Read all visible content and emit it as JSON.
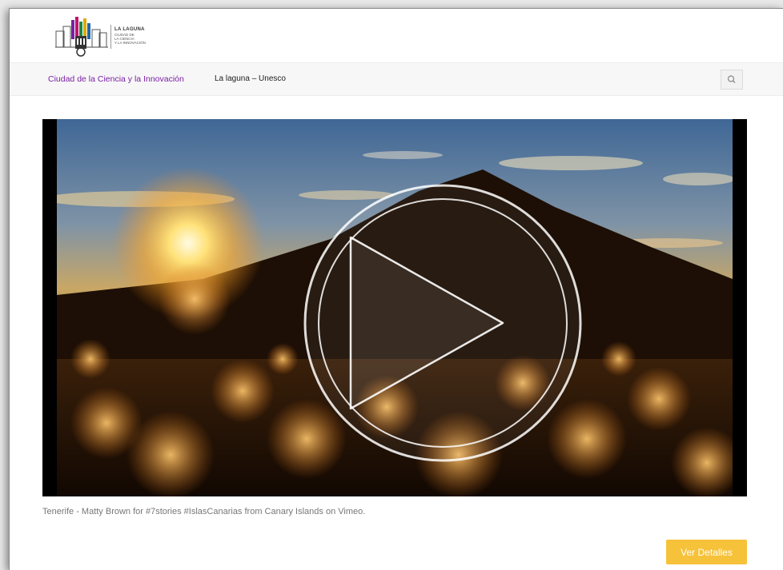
{
  "header": {
    "logo": {
      "title": "LA LAGUNA",
      "subtitle_lines": [
        "CIUDAD DE",
        "LA CIENCIA",
        "Y LA INNOVACIÓN"
      ]
    }
  },
  "nav": {
    "items": [
      {
        "label": "Ciudad de la Ciencia y la Innovación",
        "active": true
      },
      {
        "label": "La laguna – Unesco",
        "active": false
      }
    ],
    "search_icon": "search-icon"
  },
  "video": {
    "play_icon": "play-icon",
    "caption": "Tenerife - Matty Brown for #7stories #IslasCanarias from Canary Islands on Vimeo."
  },
  "actions": {
    "details_label": "Ver Detalles",
    "details_color": "#f6c23a"
  },
  "colors": {
    "accent_purple": "#7a1fa3"
  }
}
